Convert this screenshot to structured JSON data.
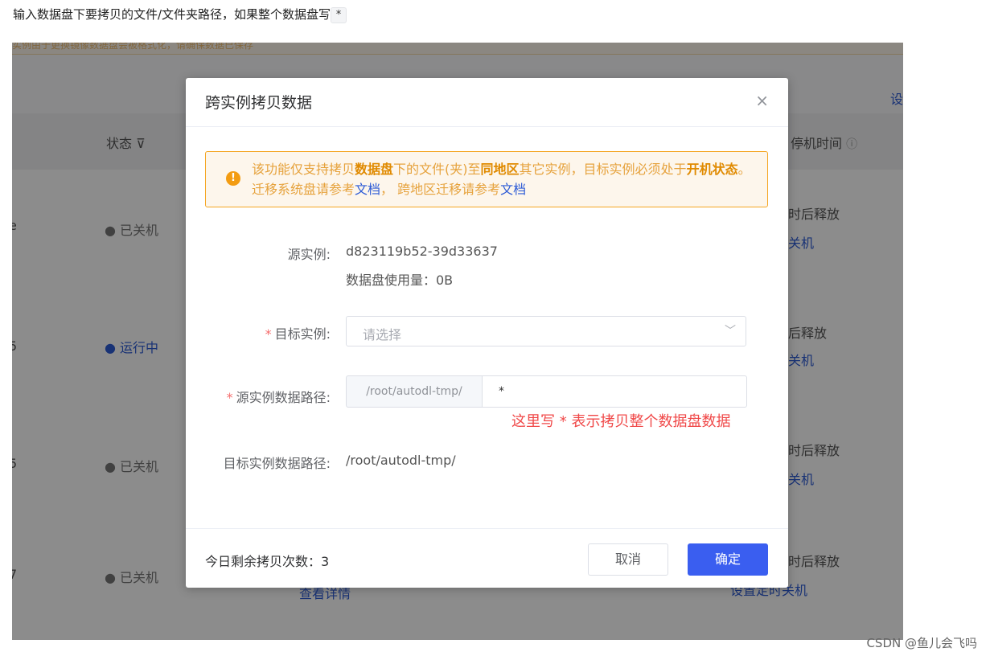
{
  "article": {
    "text": "输入数据盘下要拷贝的文件/文件夹路径，如果整个数据盘写",
    "code": "*"
  },
  "background": {
    "notice": "实例由于更换镜像数据盘会被格式化，请确保数据已保存",
    "link_right": "设",
    "columns": {
      "status": "状态",
      "stop_time": "停机时间"
    },
    "rows": [
      {
        "id_tail": "e",
        "status": "● 已关机",
        "release": "时后释放",
        "action": "关机"
      },
      {
        "id_tail": "5",
        "status": "● 运行中",
        "release": "后释放",
        "action": "关机"
      },
      {
        "id_tail": "5",
        "status": "● 已关机",
        "release": "时后释放",
        "action": "关机"
      },
      {
        "id_tail": "7",
        "status": "● 已关机",
        "release": "时后释放",
        "action": "设置定时关机",
        "detail": "查看详情"
      }
    ]
  },
  "dialog": {
    "title": "跨实例拷贝数据",
    "close": "×",
    "alert": {
      "p1": "该功能仅支持拷贝",
      "b1": "数据盘",
      "p2": "下的文件(夹)至",
      "b2": "同地区",
      "p3": "其它实例，目标实例必须处于",
      "b3": "开机状态",
      "p4": "。迁移系统盘请参考",
      "link1": "文档",
      "p5": "， 跨地区迁移请参考",
      "link2": "文档"
    },
    "source_label": "源实例:",
    "source_id": "d823119b52-39d33637",
    "disk_usage": "数据盘使用量：0B",
    "target_label": "目标实例:",
    "target_placeholder": "请选择",
    "src_path_label": "源实例数据路径:",
    "src_path_prefix": "/root/autodl-tmp/",
    "src_path_value": "*",
    "annotation": "这里写 * 表示拷贝整个数据盘数据",
    "dst_path_label": "目标实例数据路径:",
    "dst_path_value": "/root/autodl-tmp/",
    "remain": "今日剩余拷贝次数：3",
    "cancel": "取消",
    "ok": "确定"
  },
  "watermark": "CSDN @鱼儿会飞吗"
}
